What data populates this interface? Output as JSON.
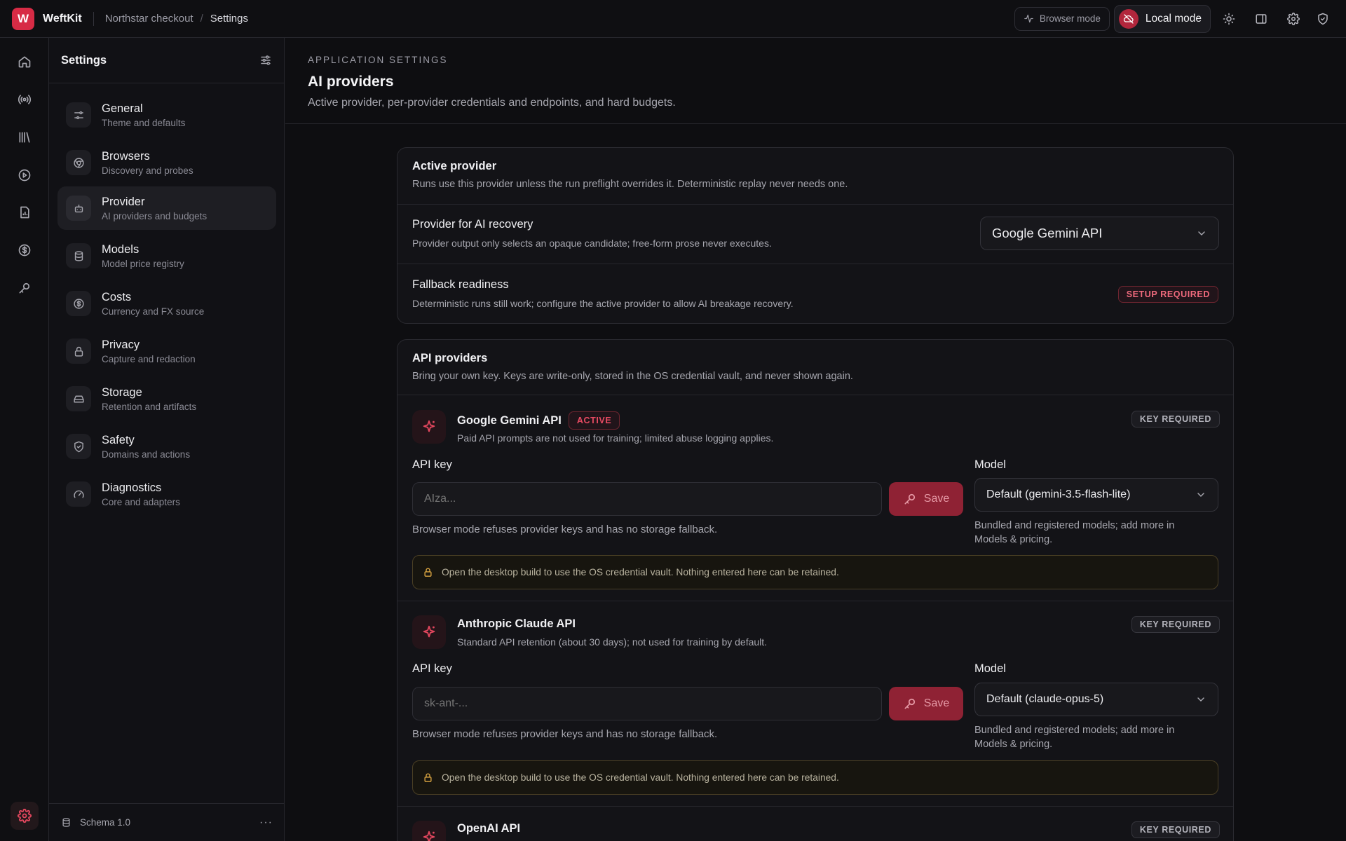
{
  "app": {
    "logo_letter": "W",
    "name": "WeftKit"
  },
  "breadcrumb": [
    "Northstar checkout",
    "Settings"
  ],
  "topbar": {
    "browser_mode": "Browser mode",
    "local_mode": "Local mode"
  },
  "settings_nav": {
    "title": "Settings",
    "items": [
      {
        "label": "General",
        "sub": "Theme and defaults",
        "icon": "sliders-icon"
      },
      {
        "label": "Browsers",
        "sub": "Discovery and probes",
        "icon": "browser-icon"
      },
      {
        "label": "Provider",
        "sub": "AI providers and budgets",
        "icon": "bot-icon"
      },
      {
        "label": "Models",
        "sub": "Model price registry",
        "icon": "database-icon"
      },
      {
        "label": "Costs",
        "sub": "Currency and FX source",
        "icon": "dollar-icon"
      },
      {
        "label": "Privacy",
        "sub": "Capture and redaction",
        "icon": "lock-icon"
      },
      {
        "label": "Storage",
        "sub": "Retention and artifacts",
        "icon": "drive-icon"
      },
      {
        "label": "Safety",
        "sub": "Domains and actions",
        "icon": "shield-icon"
      },
      {
        "label": "Diagnostics",
        "sub": "Core and adapters",
        "icon": "gauge-icon"
      }
    ],
    "footer": "Schema 1.0",
    "footer_more": "···"
  },
  "header": {
    "eyebrow": "APPLICATION SETTINGS",
    "title": "AI providers",
    "description": "Active provider, per-provider credentials and endpoints, and hard budgets."
  },
  "active_card": {
    "title": "Active provider",
    "subtitle": "Runs use this provider unless the run preflight overrides it. Deterministic replay never needs one.",
    "recovery_label": "Provider for AI recovery",
    "recovery_sub": "Provider output only selects an opaque candidate; free-form prose never executes.",
    "recovery_value": "Google Gemini API",
    "fallback_label": "Fallback readiness",
    "fallback_sub": "Deterministic runs still work; configure the active provider to allow AI breakage recovery.",
    "fallback_badge": "SETUP REQUIRED"
  },
  "api_card": {
    "title": "API providers",
    "subtitle": "Bring your own key. Keys are write-only, stored in the OS credential vault, and never shown again.",
    "providers": [
      {
        "name": "Google Gemini API",
        "active_badge": "ACTIVE",
        "sub": "Paid API prompts are not used for training; limited abuse logging applies.",
        "status": "KEY REQUIRED",
        "key_label": "API key",
        "key_placeholder": "AIza...",
        "save": "Save",
        "key_note": "Browser mode refuses provider keys and has no storage fallback.",
        "model_label": "Model",
        "model_value": "Default (gemini-3.5-flash-lite)",
        "model_note": "Bundled and registered models; add more in Models & pricing.",
        "warning": "Open the desktop build to use the OS credential vault. Nothing entered here can be retained."
      },
      {
        "name": "Anthropic Claude API",
        "sub": "Standard API retention (about 30 days); not used for training by default.",
        "status": "KEY REQUIRED",
        "key_label": "API key",
        "key_placeholder": "sk-ant-...",
        "save": "Save",
        "key_note": "Browser mode refuses provider keys and has no storage fallback.",
        "model_label": "Model",
        "model_value": "Default (claude-opus-5)",
        "model_note": "Bundled and registered models; add more in Models & pricing.",
        "warning": "Open the desktop build to use the OS credential vault. Nothing entered here can be retained."
      },
      {
        "name": "OpenAI API",
        "status": "KEY REQUIRED"
      }
    ]
  },
  "colors": {
    "accent": "#d72b45",
    "warning_border": "#4a3f24"
  }
}
